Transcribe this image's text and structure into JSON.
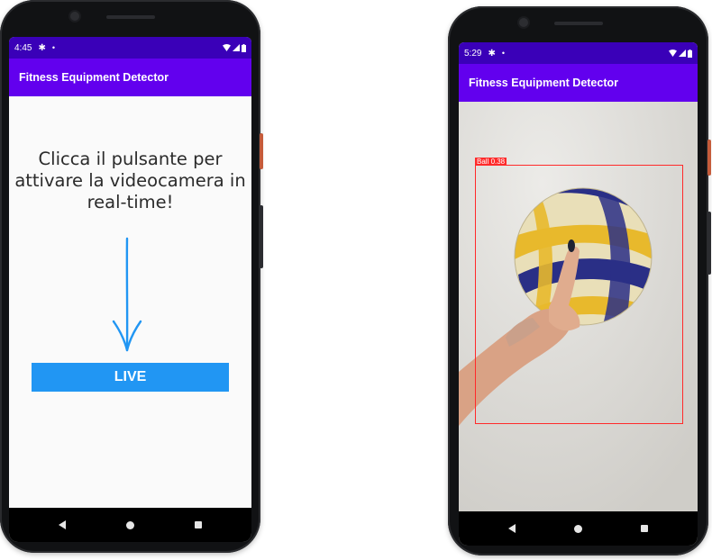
{
  "left_phone": {
    "status_bar": {
      "time": "4:45"
    },
    "app_title": "Fitness Equipment Detector",
    "instruction_text": "Clicca il pulsante per\nattivare la videocamera in\nreal-time!",
    "live_button_label": "LIVE"
  },
  "right_phone": {
    "status_bar": {
      "time": "5:29"
    },
    "app_title": "Fitness Equipment Detector",
    "detection": {
      "label": "Ball 0.38",
      "box_color": "#ff2a2a"
    }
  },
  "colors": {
    "status_bar": "#3a00b8",
    "app_bar": "#6200ee",
    "live_button": "#2196f3",
    "arrow": "#2196f3"
  },
  "icons": {
    "status_left": [
      "gear-icon",
      "dot-icon"
    ],
    "status_right": [
      "wifi-icon",
      "signal-icon",
      "battery-icon"
    ],
    "nav": [
      "back-icon",
      "home-icon",
      "recents-icon"
    ]
  }
}
